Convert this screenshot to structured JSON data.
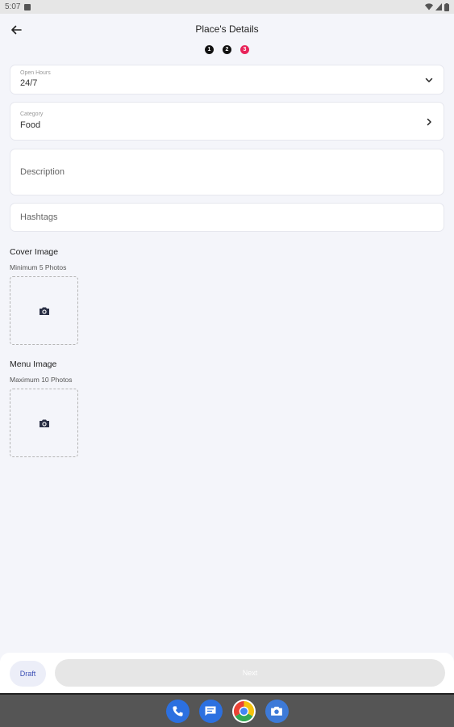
{
  "status": {
    "time": "5:07"
  },
  "header": {
    "title": "Place's Details"
  },
  "stepper": {
    "steps": [
      "1",
      "2",
      "3"
    ]
  },
  "form": {
    "open_hours": {
      "label": "Open Hours",
      "value": "24/7"
    },
    "category": {
      "label": "Category",
      "value": "Food"
    },
    "description": {
      "placeholder": "Description"
    },
    "hashtags": {
      "placeholder": "Hashtags"
    }
  },
  "cover": {
    "title": "Cover Image",
    "subtitle": "Minimum 5 Photos"
  },
  "menu": {
    "title": "Menu Image",
    "subtitle": "Maximum 10 Photos"
  },
  "actions": {
    "draft_label": "Draft",
    "next_label": "Next"
  },
  "colors": {
    "accent": "#e8245a",
    "primary": "#3b4fb5",
    "background": "#f4f5fa"
  },
  "icons": [
    "back-arrow-icon",
    "chevron-down-icon",
    "chevron-right-icon",
    "camera-icon",
    "phone-icon",
    "messages-icon",
    "chrome-icon",
    "camera-app-icon"
  ]
}
